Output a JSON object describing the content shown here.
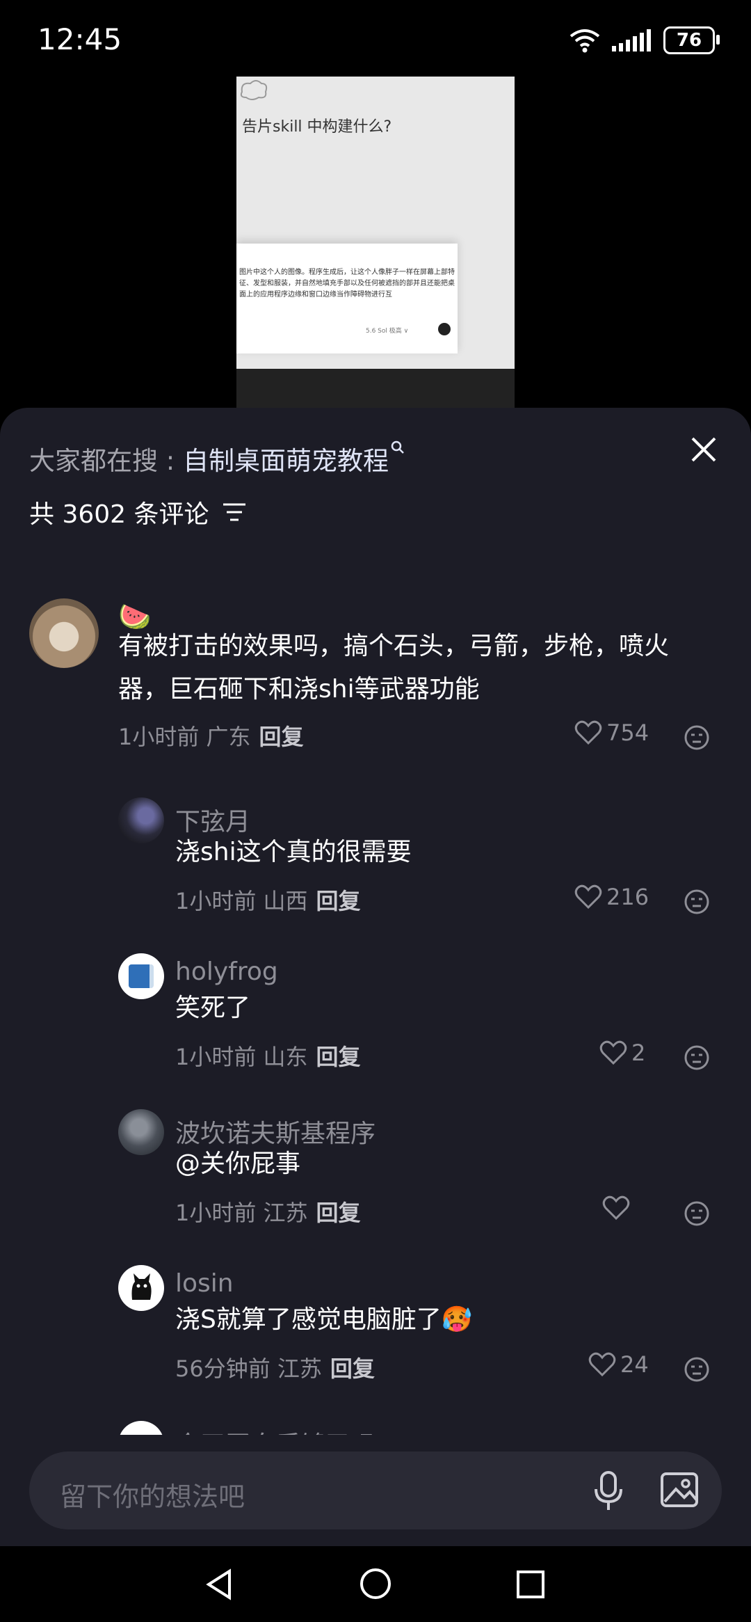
{
  "status": {
    "time": "12:45",
    "battery": "76"
  },
  "video": {
    "heading": "告片skill 中构建什么?",
    "card_text": "图片中这个人的图像。程序生成后，让这个人像胖子一样在屏幕上部特征、发型和服装，并自然地填充手部以及任何被遮挡的部并且还能把桌面上的应用程序边缘和窗口边缘当作障碍物进行互",
    "model_label": "5.6 Sol 极高 ∨"
  },
  "header": {
    "search_prefix": "大家都在搜 : ",
    "search_keyword": "自制桌面萌宠教程",
    "comment_count": "共 3602 条评论"
  },
  "comments": [
    {
      "user": "🍉",
      "text": "有被打击的效果吗，搞个石头，弓箭，步枪，喷火器，巨石砸下和浇shi等武器功能",
      "time": "1小时前 广东",
      "reply": "回复",
      "likes": "754"
    },
    {
      "user": "下弦月",
      "text": "浇shi这个真的很需要",
      "time": "1小时前 山西",
      "reply": "回复",
      "likes": "216"
    },
    {
      "user": "holyfrog",
      "text": "笑死了",
      "time": "1小时前 山东",
      "reply": "回复",
      "likes": "2"
    },
    {
      "user": "波坎诺夫斯基程序",
      "text": "@关你屁事",
      "time": "1小时前 江苏",
      "reply": "回复",
      "likes": ""
    },
    {
      "user": "losin",
      "text": "浇S就算了感觉电脑脏了🥵",
      "time": "56分钟前 江苏",
      "reply": "回复",
      "likes": "24"
    },
    {
      "user": "今天蛋白质够了吗",
      "text": "",
      "time": "",
      "reply": "",
      "likes": ""
    }
  ],
  "input": {
    "placeholder": "留下你的想法吧"
  },
  "icons": {
    "heart": "heart-outline-icon",
    "dislike": "meh-face-icon",
    "filter": "filter-lines-icon",
    "mic": "microphone-icon",
    "image": "image-icon"
  },
  "colors": {
    "sheet_bg": "#1c1c26",
    "secondary_text": "#8f8f97",
    "input_bg": "#2a2a35"
  }
}
